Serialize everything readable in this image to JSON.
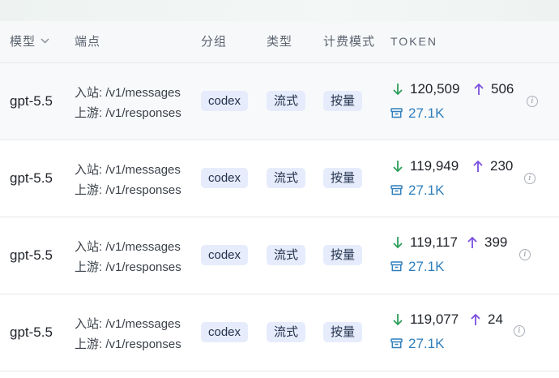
{
  "columns": {
    "model": "模型",
    "endpoint": "端点",
    "group": "分组",
    "type": "类型",
    "billing": "计费模式",
    "token": "TOKEN"
  },
  "endpoint_labels": {
    "inbound_prefix": "入站:",
    "upstream_prefix": "上游:"
  },
  "rows": [
    {
      "model": "gpt-5.5",
      "inbound": "/v1/messages",
      "upstream": "/v1/responses",
      "group": "codex",
      "type": "流式",
      "billing": "按量",
      "input_tokens": "120,509",
      "output_tokens": "506",
      "cache_tokens": "27.1K"
    },
    {
      "model": "gpt-5.5",
      "inbound": "/v1/messages",
      "upstream": "/v1/responses",
      "group": "codex",
      "type": "流式",
      "billing": "按量",
      "input_tokens": "119,949",
      "output_tokens": "230",
      "cache_tokens": "27.1K"
    },
    {
      "model": "gpt-5.5",
      "inbound": "/v1/messages",
      "upstream": "/v1/responses",
      "group": "codex",
      "type": "流式",
      "billing": "按量",
      "input_tokens": "119,117",
      "output_tokens": "399",
      "cache_tokens": "27.1K"
    },
    {
      "model": "gpt-5.5",
      "inbound": "/v1/messages",
      "upstream": "/v1/responses",
      "group": "codex",
      "type": "流式",
      "billing": "按量",
      "input_tokens": "119,077",
      "output_tokens": "24",
      "cache_tokens": "27.1K"
    }
  ],
  "colors": {
    "input_arrow": "#2e9e5b",
    "output_arrow": "#7b4fe0",
    "cache": "#2f7fbd",
    "tag_bg": "#e6ecfb",
    "header_bg": "#f7f8fa"
  },
  "icons": {
    "sort": "chevron-down-icon",
    "input": "arrow-down-icon",
    "output": "arrow-up-icon",
    "cache": "archive-box-icon",
    "info": "info-icon"
  }
}
